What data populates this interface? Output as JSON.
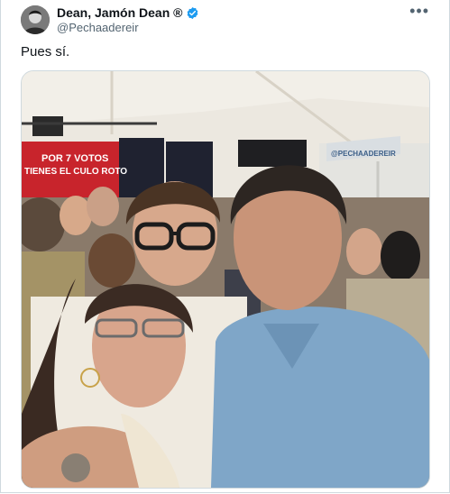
{
  "tweet": {
    "author": {
      "display_name": "Dean, Jamón Dean ®",
      "handle": "@Pechaadereir",
      "verified": true,
      "avatar_icon": "person-avatar-icon"
    },
    "more_label": "•••",
    "text": "Pues sí.",
    "media": {
      "banner_line1": "POR 7 VOTOS",
      "banner_line2": "TIENES EL CULO ROTO",
      "tent_sign": "@PECHAADEREIR"
    }
  },
  "colors": {
    "verified": "#1d9bf0",
    "banner": "#c8242c",
    "shirt": "#7fa6c8"
  }
}
